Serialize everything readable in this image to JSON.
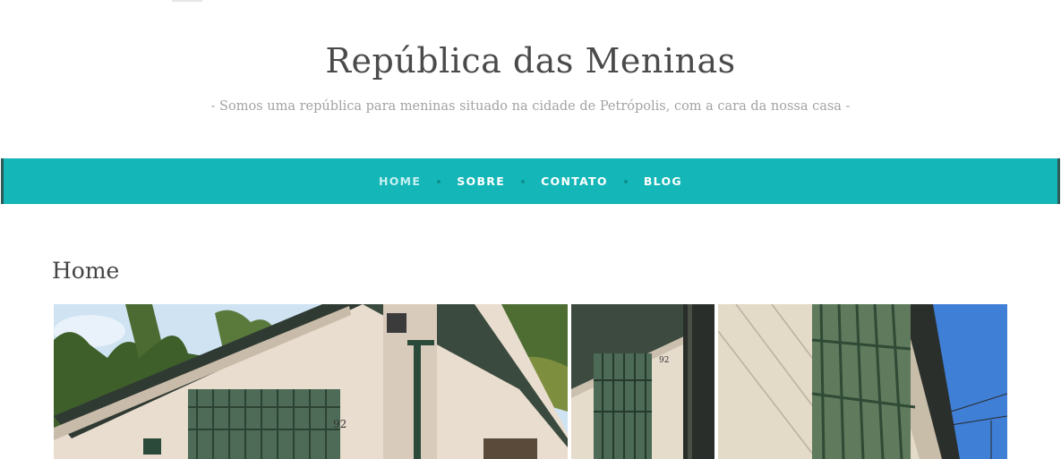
{
  "site": {
    "title": "República das Meninas",
    "tagline": "- Somos uma república para meninas situado na cidade de Petrópolis, com a cara da nossa casa -"
  },
  "nav": {
    "items": [
      {
        "label": "HOME",
        "active": true
      },
      {
        "label": "SOBRE",
        "active": false
      },
      {
        "label": "CONTATO",
        "active": false
      },
      {
        "label": "BLOG",
        "active": false
      }
    ]
  },
  "page": {
    "heading": "Home"
  },
  "gallery": {
    "photos": [
      "house-front-photo",
      "house-window-photo",
      "house-wall-photo"
    ],
    "house_number": "92"
  },
  "colors": {
    "nav_background": "#14b6b7",
    "nav_active_text": "#c8f1f1",
    "title_text": "#4a4a4a",
    "tagline_text": "#a3a3a3"
  }
}
